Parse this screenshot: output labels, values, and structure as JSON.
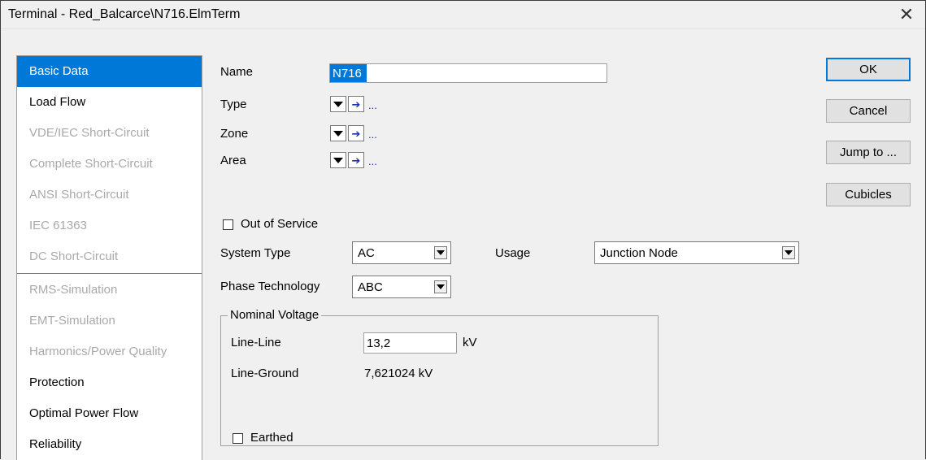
{
  "window": {
    "title": "Terminal - Red_Balcarce\\N716.ElmTerm",
    "close": "✕"
  },
  "sidebar": {
    "items": [
      {
        "label": "Basic Data"
      },
      {
        "label": "Load Flow"
      },
      {
        "label": "VDE/IEC Short-Circuit"
      },
      {
        "label": "Complete Short-Circuit"
      },
      {
        "label": "ANSI Short-Circuit"
      },
      {
        "label": "IEC 61363"
      },
      {
        "label": "DC Short-Circuit"
      },
      {
        "label": "RMS-Simulation"
      },
      {
        "label": "EMT-Simulation"
      },
      {
        "label": "Harmonics/Power Quality"
      },
      {
        "label": "Protection"
      },
      {
        "label": "Optimal Power Flow"
      },
      {
        "label": "Reliability"
      }
    ],
    "selected": "Basic Data"
  },
  "form": {
    "name_label": "Name",
    "name_value": "N716",
    "type_label": "Type",
    "zone_label": "Zone",
    "area_label": "Area",
    "ellipsis": "...",
    "out_of_service_label": "Out of Service",
    "out_of_service_checked": false,
    "system_type_label": "System Type",
    "system_type_value": "AC",
    "usage_label": "Usage",
    "usage_value": "Junction Node",
    "phase_technology_label": "Phase Technology",
    "phase_technology_value": "ABC",
    "nominal_voltage": {
      "legend": "Nominal Voltage",
      "line_line_label": "Line-Line",
      "line_line_value": "13,2",
      "line_line_unit": "kV",
      "line_ground_label": "Line-Ground",
      "line_ground_value": "7,621024 kV"
    },
    "earthed_label": "Earthed",
    "earthed_checked": false
  },
  "buttons": {
    "ok": "OK",
    "cancel": "Cancel",
    "jump_to": "Jump to ...",
    "cubicles": "Cubicles"
  },
  "colors": {
    "selection": "#0078d7",
    "disabled_text": "#a9a9a9",
    "link_arrow": "#1a2fb0"
  }
}
